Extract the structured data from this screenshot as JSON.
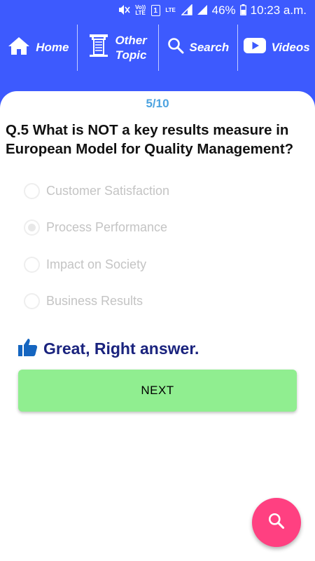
{
  "status_bar": {
    "volte_label": "Vo)) LTE",
    "sim_label": "1",
    "lte_label": "LTE",
    "battery": "46%",
    "time": "10:23 a.m."
  },
  "nav": {
    "home_label": "Home",
    "other_label_line1": "Other",
    "other_label_line2": "Topic",
    "search_label": "Search",
    "videos_label": "Videos"
  },
  "quiz": {
    "progress": "5/10",
    "question": "Q.5 What is NOT a key results measure in European Model for Quality Management?",
    "options": [
      "Customer Satisfaction",
      "Process Performance",
      "Impact on Society",
      "Business Results"
    ],
    "selected_index": 1,
    "feedback": "Great, Right answer.",
    "next_label": "NEXT"
  },
  "colors": {
    "header": "#3d5afe",
    "next_button": "#90ee90",
    "fab": "#ff4081",
    "progress_text": "#4da3e0",
    "feedback_text": "#1a237e"
  }
}
